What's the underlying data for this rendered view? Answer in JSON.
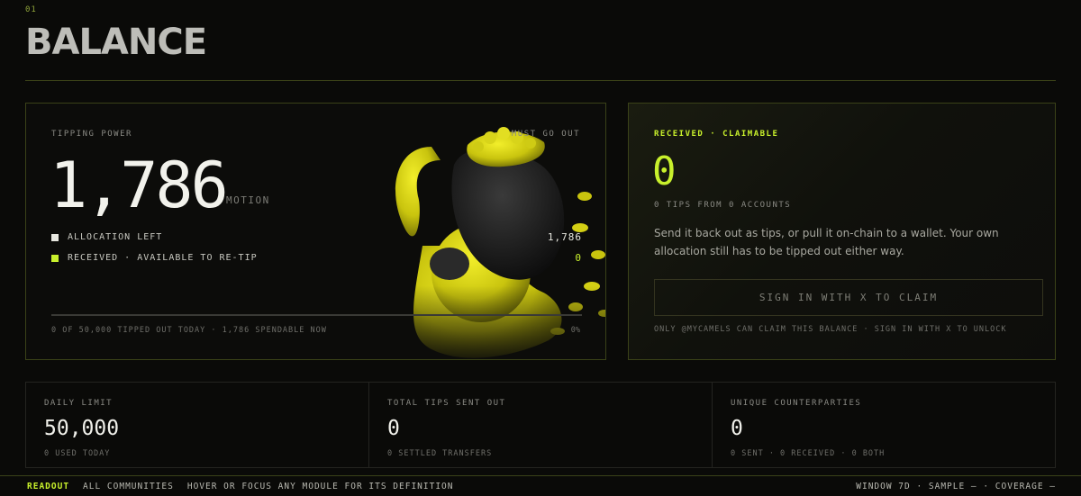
{
  "section": {
    "number": "01",
    "title": "BALANCE"
  },
  "colors": {
    "accent": "#c8f02c",
    "border": "#3a4218",
    "background": "#0a0a08"
  },
  "tipping": {
    "label": "TIPPING POWER",
    "tag": "MUST GO OUT",
    "value": "1,786",
    "unit": "MOTION",
    "legend": [
      {
        "label": "ALLOCATION LEFT",
        "value": "1,786",
        "color": "#e8e8e0"
      },
      {
        "label": "RECEIVED · AVAILABLE TO RE-TIP",
        "value": "0",
        "color": "#c8f02c"
      }
    ],
    "progress_fraction": 0.0,
    "footer": "0 OF 50,000 TIPPED OUT TODAY · 1,786 SPENDABLE NOW",
    "percent": "0%",
    "mascot_icon": "money-bag-mascot-icon"
  },
  "claim": {
    "label": "RECEIVED · CLAIMABLE",
    "value": "0",
    "subtitle": "0 TIPS FROM 0 ACCOUNTS",
    "description": "Send it back out as tips, or pull it on-chain to a wallet. Your own allocation still has to be tipped out either way.",
    "button_label": "SIGN IN WITH X TO CLAIM",
    "footer": "ONLY @MYCAMELS CAN CLAIM THIS BALANCE · SIGN IN WITH X TO UNLOCK"
  },
  "stats": [
    {
      "label": "DAILY LIMIT",
      "value": "50,000",
      "sub": "0 USED TODAY"
    },
    {
      "label": "TOTAL TIPS SENT OUT",
      "value": "0",
      "sub": "0 SETTLED TRANSFERS"
    },
    {
      "label": "UNIQUE COUNTERPARTIES",
      "value": "0",
      "sub": "0 SENT · 0 RECEIVED · 0 BOTH"
    }
  ],
  "bottombar": {
    "readout": "READOUT",
    "community": "ALL COMMUNITIES",
    "hint": "HOVER OR FOCUS ANY MODULE FOR ITS DEFINITION",
    "status": "WINDOW 7D · SAMPLE — · COVERAGE —"
  }
}
